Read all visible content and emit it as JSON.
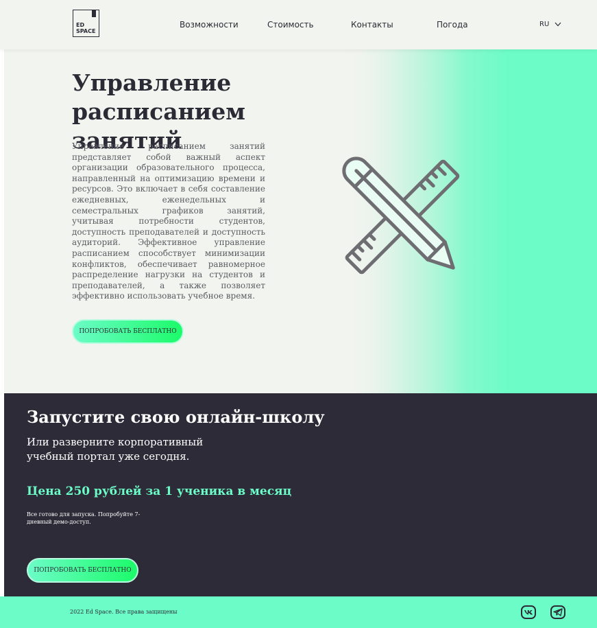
{
  "header": {
    "logo_text": [
      "ED",
      "SPACE"
    ],
    "nav": [
      "Возможности",
      "Стоимость",
      "Контакты",
      "Погода"
    ],
    "language": "RU"
  },
  "hero": {
    "title_lines": [
      "Управление",
      "расписанием занятий"
    ],
    "description": "Управление расписанием занятий представляет собой важный аспект организации образовательного процесса, направленный на оптимизацию времени и ресурсов. Это включает в себя составление ежедневных, еженедельных и семестральных графиков занятий, учитывая потребности студентов, доступность преподавателей и доступность аудиторий. Эффективное управление расписанием способствует минимизации конфликтов, обеспечивает равномерное распределение нагрузки на студентов и преподавателей, а также позволяет эффективно использовать учебное время.",
    "cta": "ПОПРОБОВАТЬ БЕСПЛАТНО",
    "illustration_icon": "pencil-ruler-icon"
  },
  "promo": {
    "title": "Запустите свою онлайн-школу",
    "subtitle": "Или разверните корпоративный учебный портал уже сегодня.",
    "price": "Цена 250 рублей за 1 ученика в месяц",
    "note": "Все готово для запуска. Попробуйте 7-дневный демо-доступ.",
    "cta": "ПОПРОБОВАТЬ БЕСПЛАТНО"
  },
  "footer": {
    "copyright": "2022 Ed Space. Все права защищены",
    "social": [
      "vk-icon",
      "telegram-icon"
    ]
  },
  "colors": {
    "accent": "#6cfcc7",
    "accent_strong": "#1cfb6a",
    "dark": "#2d2b37",
    "light_bg": "#f2f4ef",
    "text": "#2b2a35"
  }
}
